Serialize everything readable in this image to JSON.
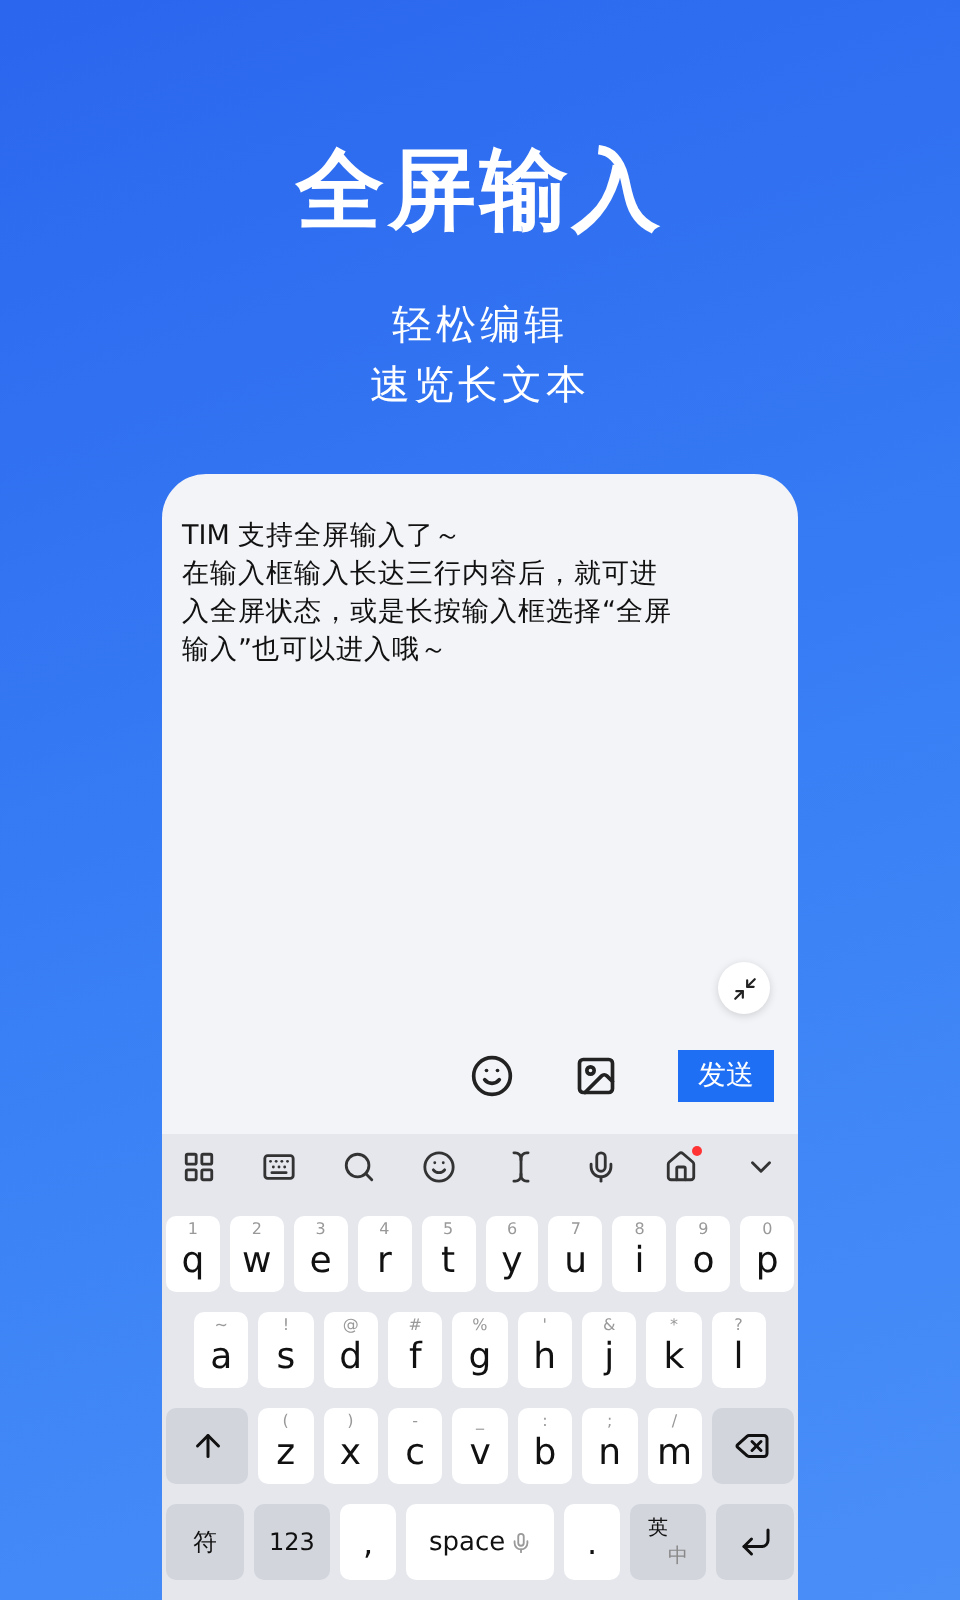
{
  "hero": {
    "title": "全屏输入",
    "subtitles": [
      "轻松编辑",
      "速览长文本"
    ]
  },
  "editor": {
    "lines": [
      "TIM 支持全屏输入了～",
      "在输入框输入长达三行内容后，就可进",
      "入全屏状态，或是长按输入框选择“全屏",
      "输入”也可以进入哦～"
    ],
    "send": "发送"
  },
  "keyboard_toolbar": {
    "home_badge": true
  },
  "keyboard": {
    "rows": [
      {
        "keys": [
          {
            "kind": "letter",
            "label": "q",
            "hint": "1"
          },
          {
            "kind": "letter",
            "label": "w",
            "hint": "2"
          },
          {
            "kind": "letter",
            "label": "e",
            "hint": "3"
          },
          {
            "kind": "letter",
            "label": "r",
            "hint": "4"
          },
          {
            "kind": "letter",
            "label": "t",
            "hint": "5"
          },
          {
            "kind": "letter",
            "label": "y",
            "hint": "6"
          },
          {
            "kind": "letter",
            "label": "u",
            "hint": "7"
          },
          {
            "kind": "letter",
            "label": "i",
            "hint": "8"
          },
          {
            "kind": "letter",
            "label": "o",
            "hint": "9"
          },
          {
            "kind": "letter",
            "label": "p",
            "hint": "0"
          }
        ]
      },
      {
        "keys": [
          {
            "kind": "letter",
            "label": "a",
            "hint": "~"
          },
          {
            "kind": "letter",
            "label": "s",
            "hint": "!"
          },
          {
            "kind": "letter",
            "label": "d",
            "hint": "@"
          },
          {
            "kind": "letter",
            "label": "f",
            "hint": "#"
          },
          {
            "kind": "letter",
            "label": "g",
            "hint": "%"
          },
          {
            "kind": "letter",
            "label": "h",
            "hint": "'"
          },
          {
            "kind": "letter",
            "label": "j",
            "hint": "&"
          },
          {
            "kind": "letter",
            "label": "k",
            "hint": "*"
          },
          {
            "kind": "letter",
            "label": "l",
            "hint": "?"
          }
        ]
      },
      {
        "keys": [
          {
            "kind": "shift"
          },
          {
            "kind": "letter",
            "label": "z",
            "hint": "("
          },
          {
            "kind": "letter",
            "label": "x",
            "hint": ")"
          },
          {
            "kind": "letter",
            "label": "c",
            "hint": "-"
          },
          {
            "kind": "letter",
            "label": "v",
            "hint": "_"
          },
          {
            "kind": "letter",
            "label": "b",
            "hint": ":"
          },
          {
            "kind": "letter",
            "label": "n",
            "hint": ";"
          },
          {
            "kind": "letter",
            "label": "m",
            "hint": "/"
          },
          {
            "kind": "backspace"
          }
        ]
      },
      {
        "keys": [
          {
            "kind": "function",
            "label": "符"
          },
          {
            "kind": "function",
            "label": "123"
          },
          {
            "kind": "punct",
            "label": ","
          },
          {
            "kind": "space",
            "label": "space"
          },
          {
            "kind": "punct",
            "label": "."
          },
          {
            "kind": "lang",
            "label": "英",
            "sub": "中"
          },
          {
            "kind": "enter"
          }
        ]
      }
    ]
  }
}
